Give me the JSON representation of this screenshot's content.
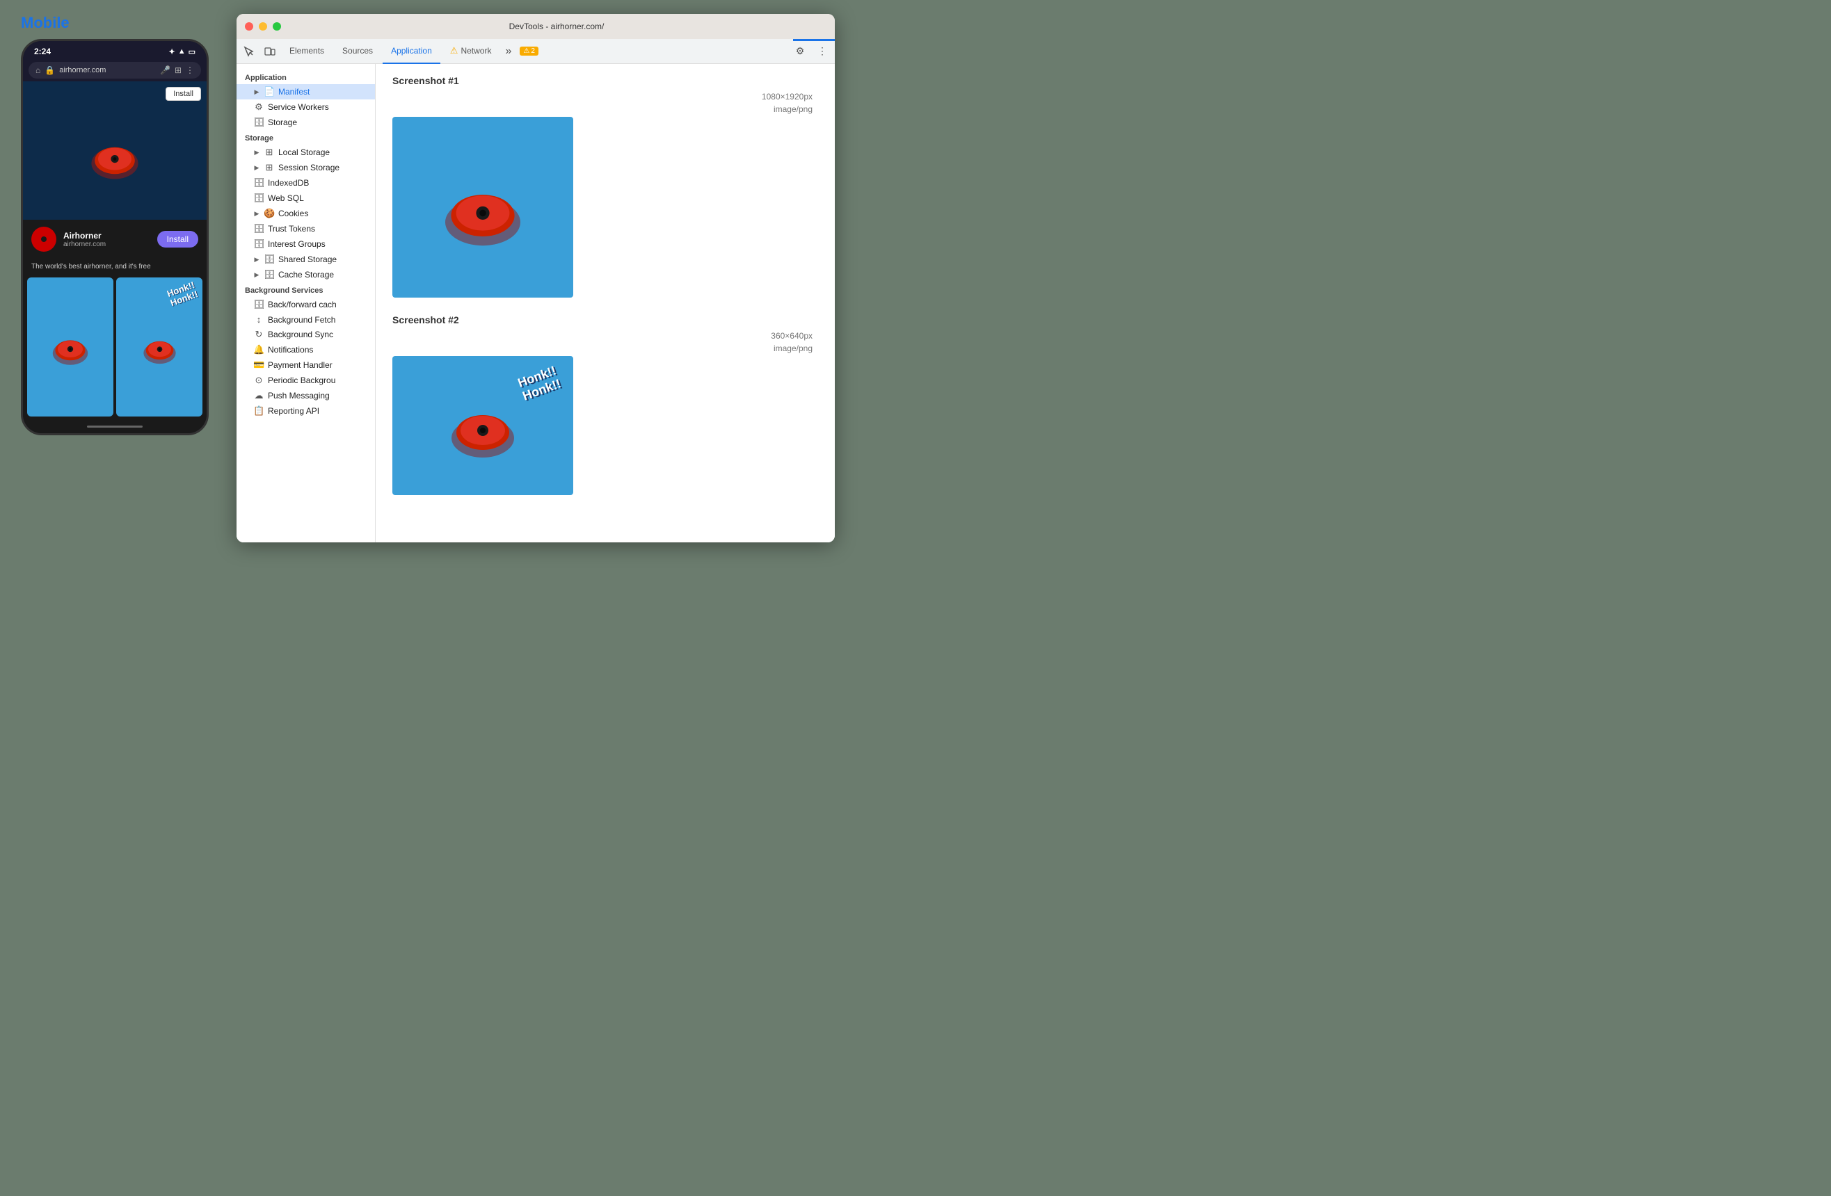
{
  "page": {
    "mobile_label": "Mobile",
    "phone": {
      "time": "2:24",
      "url": "airhorner.com",
      "install_btn_top": "Install",
      "app_name": "Airhorner",
      "app_url": "airhorner.com",
      "install_btn_banner": "Install",
      "promo_text": "The world's best airhorner, and it's free"
    },
    "devtools": {
      "title": "DevTools - airhorner.com/",
      "tabs": [
        "Elements",
        "Sources",
        "Application",
        "Network"
      ],
      "active_tab": "Application",
      "warning_count": "2",
      "sidebar": {
        "application_label": "Application",
        "items_app": [
          "Manifest",
          "Service Workers",
          "Storage"
        ],
        "storage_label": "Storage",
        "items_storage": [
          "Local Storage",
          "Session Storage",
          "IndexedDB",
          "Web SQL",
          "Cookies",
          "Trust Tokens",
          "Interest Groups",
          "Shared Storage",
          "Cache Storage"
        ],
        "background_label": "Background Services",
        "items_bg": [
          "Back/forward cach",
          "Background Fetch",
          "Background Sync",
          "Notifications",
          "Payment Handler",
          "Periodic Backgrou",
          "Push Messaging",
          "Reporting API"
        ]
      },
      "main": {
        "screenshot1": {
          "title": "Screenshot #1",
          "dimensions": "1080×1920px",
          "type": "image/png"
        },
        "screenshot2": {
          "title": "Screenshot #2",
          "dimensions": "360×640px",
          "type": "image/png"
        }
      }
    }
  }
}
